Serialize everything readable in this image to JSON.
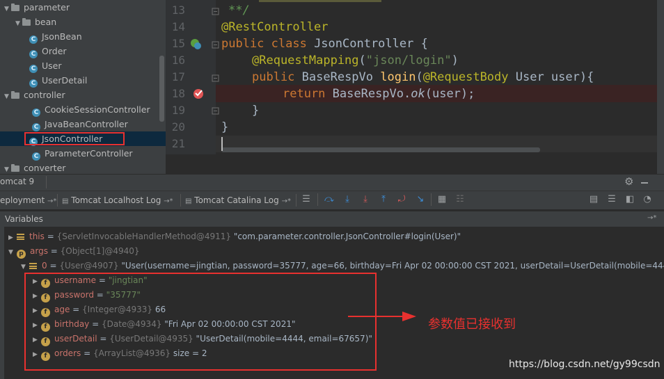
{
  "project_tree": {
    "items": [
      {
        "label": "parameter",
        "kind": "folder"
      },
      {
        "label": "bean",
        "kind": "folder"
      },
      {
        "label": "JsonBean",
        "kind": "class"
      },
      {
        "label": "Order",
        "kind": "class"
      },
      {
        "label": "User",
        "kind": "class"
      },
      {
        "label": "UserDetail",
        "kind": "class"
      },
      {
        "label": "controller",
        "kind": "folder"
      },
      {
        "label": "CookieSessionController",
        "kind": "class"
      },
      {
        "label": "JavaBeanController",
        "kind": "class"
      },
      {
        "label": "JsonController",
        "kind": "class",
        "selected": true
      },
      {
        "label": "ParameterController",
        "kind": "class"
      },
      {
        "label": "converter",
        "kind": "folder"
      }
    ],
    "class_icon_letter": "C"
  },
  "editor": {
    "line_numbers": [
      "13",
      "14",
      "15",
      "16",
      "17",
      "18",
      "19",
      "20",
      "21"
    ],
    "code": {
      "l13": "**/",
      "l14": "@RestController",
      "l15_kw": "public class",
      "l15_rest": " JsonController {",
      "l16_an": "@RequestMapping",
      "l16_p1": "(",
      "l16_str": "\"json/login\"",
      "l16_p2": ")",
      "l17_kw": "public",
      "l17_type": " BaseRespVo ",
      "l17_fn": "login",
      "l17_p": "(",
      "l17_an": "@RequestBody",
      "l17_rest": " User user){",
      "l18_kw": "return",
      "l18_obj": " BaseRespVo.",
      "l18_fn": "ok",
      "l18_rest": "(user);",
      "l19": "}",
      "l20": "}"
    }
  },
  "debug": {
    "title_tab": "omcat 9",
    "tabs": [
      "eployment",
      "Tomcat Localhost Log",
      "Tomcat Catalina Log"
    ],
    "tab_suffix": "→*",
    "variables_title": "Variables",
    "variables_pin": "→*"
  },
  "variables": {
    "this": {
      "name": "this",
      "eq": " = ",
      "type": "{ServletInvocableHandlerMethod@4911}",
      "value": " \"com.parameter.controller.JsonController#login(User)\""
    },
    "args": {
      "name": "args",
      "eq": " = ",
      "type": "{Object[1]@4940}"
    },
    "arg0": {
      "name": "0",
      "eq": " = ",
      "type": "{User@4907}",
      "value": " \"User(username=jingtian, password=35777, age=66, birthday=Fri Apr 02 00:00:00 CST 2021, userDetail=UserDetail(mobile=4444, em"
    },
    "fields": [
      {
        "name": "username",
        "eq": " = ",
        "type": "",
        "value": "\"jingtian\"",
        "is_string": true
      },
      {
        "name": "password",
        "eq": " = ",
        "type": "",
        "value": "\"35777\"",
        "is_string": true
      },
      {
        "name": "age",
        "eq": " = ",
        "type": "{Integer@4933}",
        "value": " 66",
        "is_string": false
      },
      {
        "name": "birthday",
        "eq": " = ",
        "type": "{Date@4934}",
        "value": " \"Fri Apr 02 00:00:00 CST 2021\"",
        "is_string": false
      },
      {
        "name": "userDetail",
        "eq": " = ",
        "type": "{UserDetail@4935}",
        "value": " \"UserDetail(mobile=4444, email=67657)\"",
        "is_string": false
      },
      {
        "name": "orders",
        "eq": " = ",
        "type": "{ArrayList@4936}",
        "value": "  size = 2",
        "is_string": false
      }
    ],
    "field_icon_letter": "f",
    "param_icon_letter": "p"
  },
  "annotation": {
    "text": "参数值已接收到"
  },
  "watermark": {
    "text": "https://blog.csdn.net/gy99csdn"
  },
  "colors": {
    "highlight_box": "#e8312f",
    "selection": "#0d293e",
    "breakpoint": "#e05555"
  }
}
